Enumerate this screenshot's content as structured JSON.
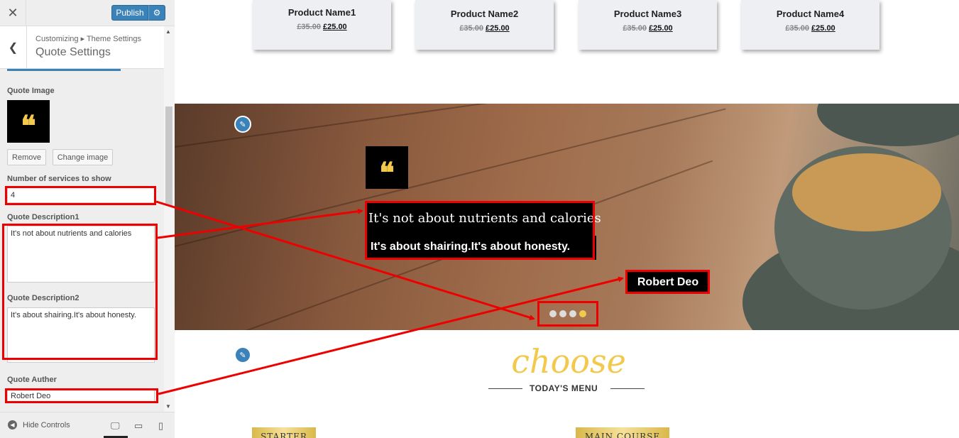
{
  "sidebar": {
    "close_icon": "close-icon",
    "publish_label": "Publish",
    "settings_icon": "gear-icon",
    "breadcrumb": "Customizing ▸ Theme Settings",
    "title": "Quote Settings",
    "quote_image_label": "Quote Image",
    "remove_label": "Remove",
    "change_image_label": "Change image",
    "services_label": "Number of services to show",
    "services_value": "4",
    "desc1_label": "Quote Description1",
    "desc1_value": "It's not about nutrients and calories",
    "desc2_label": "Quote Description2",
    "desc2_value": "It's about shairing.It's about honesty.",
    "author_label": "Quote Auther",
    "author_value": "Robert Deo",
    "hide_controls": "Hide Controls"
  },
  "products": [
    {
      "name": "Product Name1",
      "old_price": "£35.00",
      "price": "£25.00"
    },
    {
      "name": "Product Name2",
      "old_price": "£35.00",
      "price": "£25.00"
    },
    {
      "name": "Product Name3",
      "old_price": "£35.00",
      "price": "£25.00"
    },
    {
      "name": "Product Name4",
      "old_price": "£35.00",
      "price": "£25.00"
    }
  ],
  "hero": {
    "quote_mark": "❝",
    "line1": "It's not about nutrients and calories",
    "line2": "It's about shairing.It's about honesty.",
    "author": "Robert Deo",
    "dots_total": 4,
    "active_dot": 4
  },
  "section": {
    "heading": "choose",
    "subheading": "TODAY'S MENU",
    "tile1": "STARTER",
    "tile2": "MAIN COURSE"
  },
  "colors": {
    "accent": "#f2c94c",
    "publish_blue": "#3a82b8",
    "annotation_red": "#e00000"
  }
}
